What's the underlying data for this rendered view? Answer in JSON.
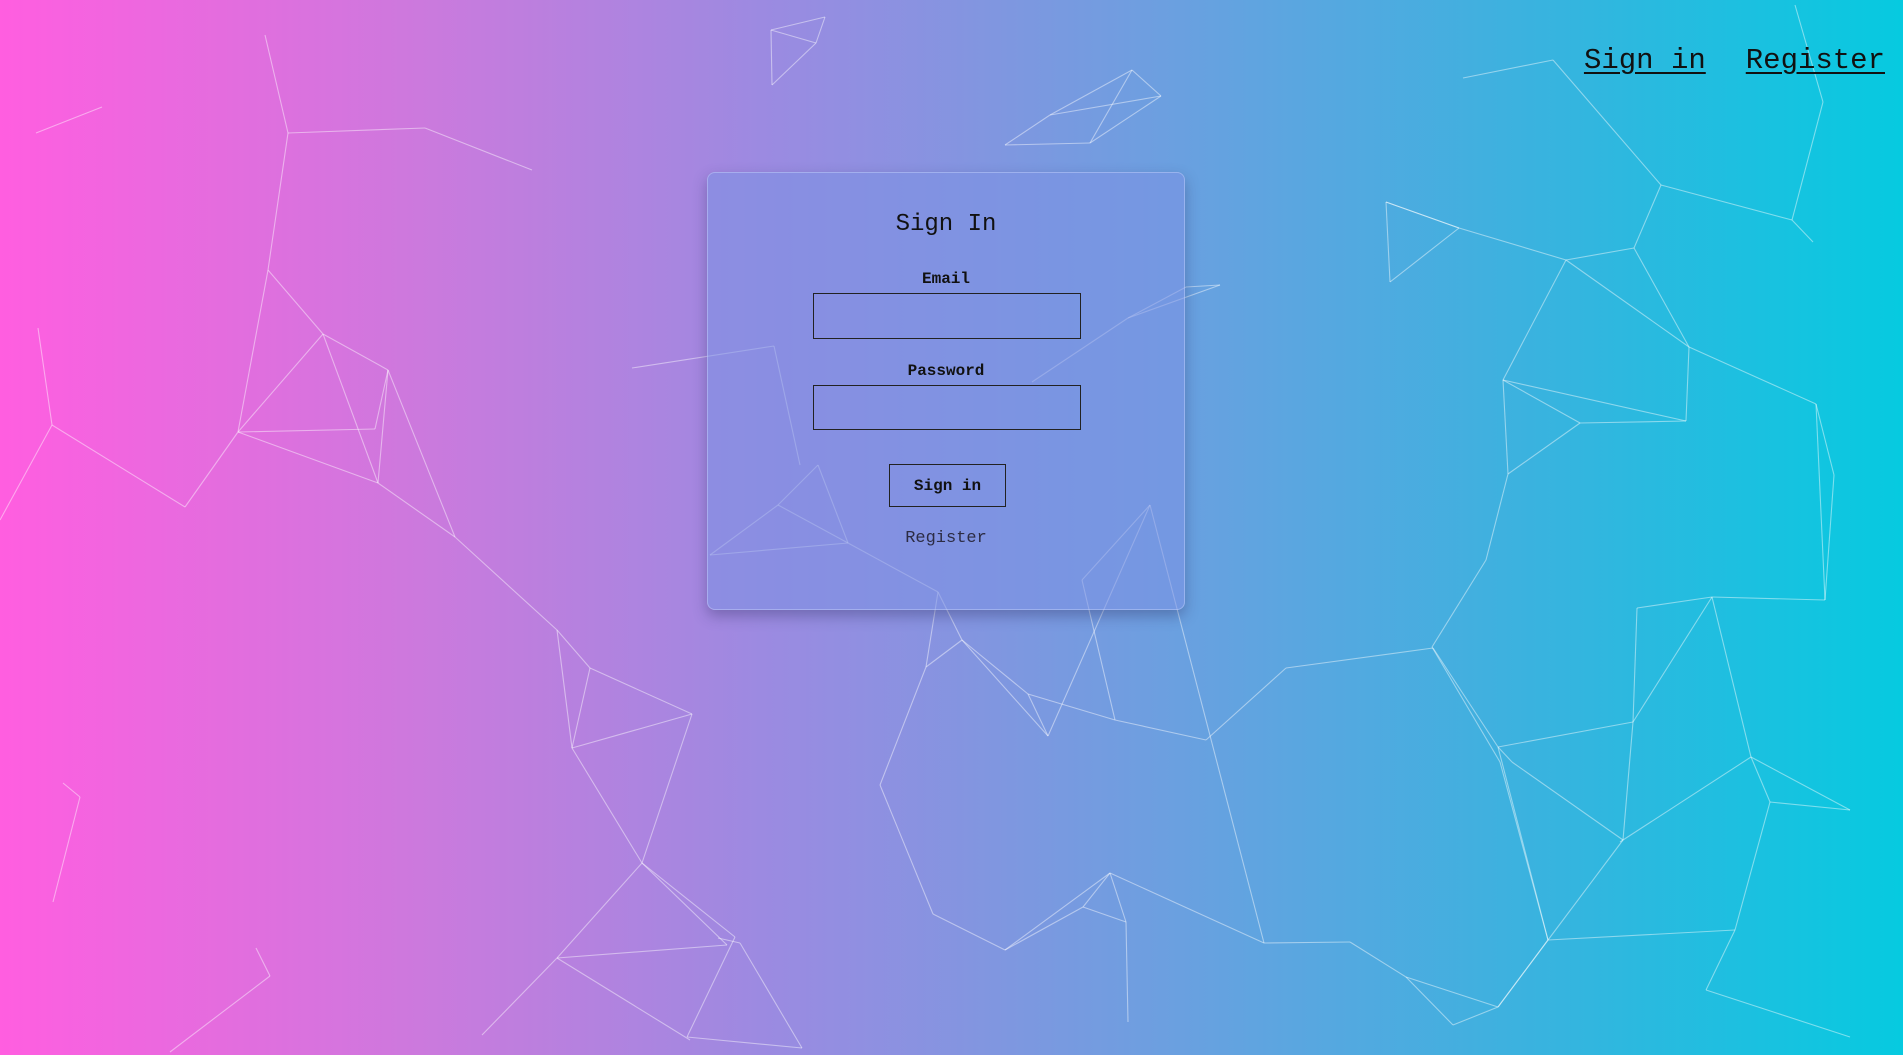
{
  "nav": {
    "sign_in": "Sign in",
    "register": "Register"
  },
  "form": {
    "title": "Sign In",
    "email_label": "Email",
    "email_value": "",
    "password_label": "Password",
    "password_value": "",
    "submit_label": "Sign in",
    "register_link": "Register"
  },
  "colors": {
    "gradient_left": "#ff5ee0",
    "gradient_right": "#06cae0",
    "card_background": "#7c91e4"
  }
}
